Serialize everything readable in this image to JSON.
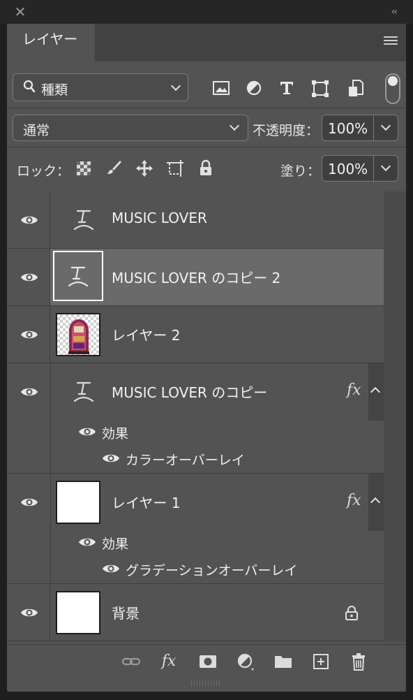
{
  "window": {
    "close_glyph": "✕",
    "collapse_glyph": "‹‹"
  },
  "tab": {
    "label": "レイヤー"
  },
  "filter": {
    "kind_label": "種類",
    "icons": [
      "image-filter-icon",
      "adjustment-filter-icon",
      "type-filter-icon",
      "shape-filter-icon",
      "smart-object-filter-icon"
    ]
  },
  "blend": {
    "mode": "通常",
    "opacity_label": "不透明度：",
    "opacity_value": "100%"
  },
  "lock": {
    "label": "ロック：",
    "fill_label": "塗り：",
    "fill_value": "100%"
  },
  "layers": [
    {
      "name": "MUSIC LOVER",
      "kind": "text",
      "visible": true,
      "selected": false
    },
    {
      "name": "MUSIC LOVER のコピー 2",
      "kind": "text",
      "visible": true,
      "selected": true
    },
    {
      "name": "レイヤー 2",
      "kind": "image",
      "visible": true,
      "selected": false
    },
    {
      "name": "MUSIC LOVER のコピー",
      "kind": "text",
      "visible": true,
      "fx": "fx",
      "effects_label": "効果",
      "effects": [
        "カラーオーバーレイ"
      ]
    },
    {
      "name": "レイヤー 1",
      "kind": "fill",
      "visible": true,
      "fx": "fx",
      "effects_label": "効果",
      "effects": [
        "グラデーションオーバーレイ"
      ]
    },
    {
      "name": "背景",
      "kind": "background",
      "visible": true,
      "locked": true
    }
  ],
  "footer": {
    "fx_label": "fx",
    "icons": [
      "link-icon",
      "fx-icon",
      "mask-icon",
      "adjustment-icon",
      "folder-icon",
      "new-layer-icon",
      "trash-icon"
    ]
  }
}
